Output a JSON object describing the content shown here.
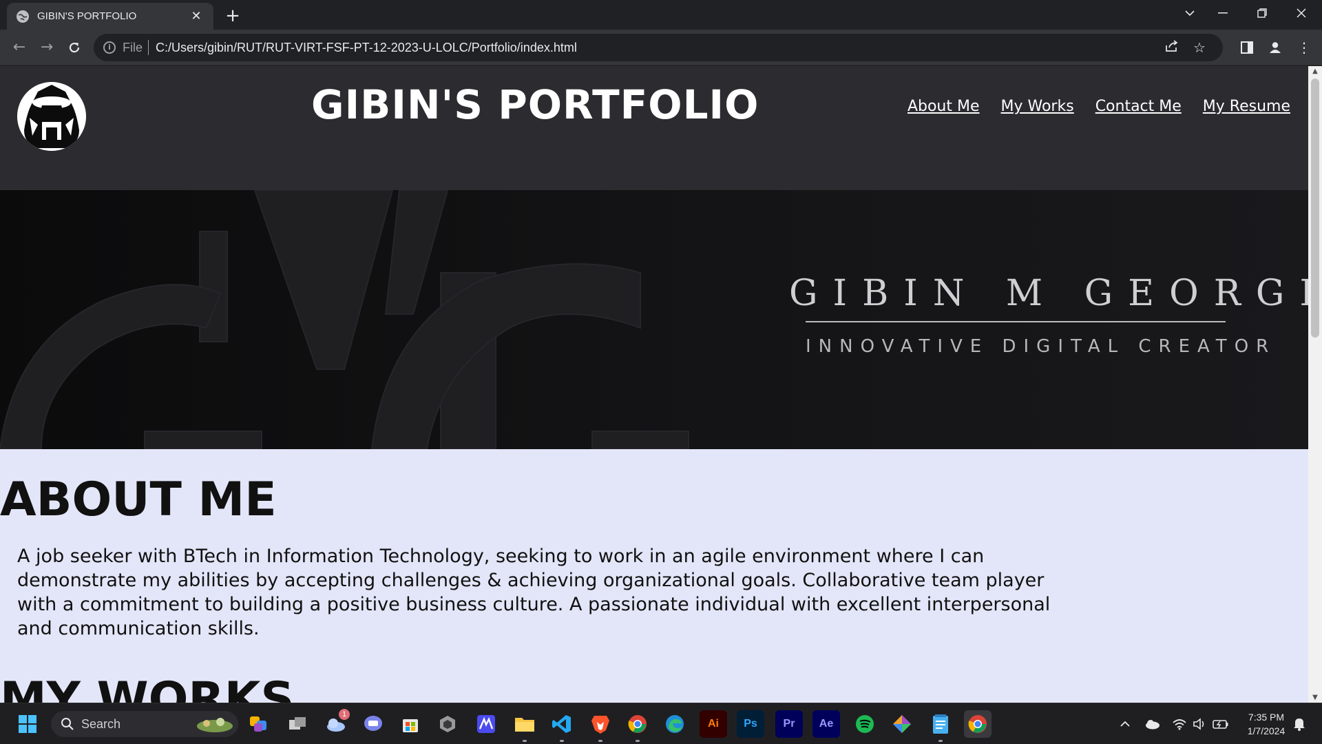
{
  "browser": {
    "tab_title": "GIBIN'S PORTFOLIO",
    "omnibox_scheme": "File",
    "url": "C:/Users/gibin/RUT/RUT-VIRT-FSF-PT-12-2023-U-LOLC/Portfolio/index.html"
  },
  "site": {
    "title": "GIBIN'S PORTFOLIO",
    "nav": [
      "About Me",
      "My Works",
      "Contact Me",
      "My Resume"
    ],
    "banner_name": "GIBIN M GEORGE",
    "banner_subtitle": "INNOVATIVE DIGITAL CREATOR",
    "about_heading": "ABOUT ME",
    "about_text": "A job seeker with BTech in Information Technology, seeking to work in an agile environment where I can demonstrate my abilities by accepting challenges & achieving organizational goals. Collaborative team player with a commitment to building a positive business culture. A passionate individual with excellent interpersonal and communication skills.",
    "works_heading": "MY WORKS"
  },
  "taskbar": {
    "search_label": "Search",
    "notification_badge": "1",
    "apps": {
      "illustrator": "Ai",
      "photoshop": "Ps",
      "premiere": "Pr",
      "after_effects": "Ae"
    },
    "time": "7:35 PM",
    "date": "1/7/2024"
  },
  "colors": {
    "header_bg": "#2b2b30",
    "page_bg": "#e3e6f8",
    "chrome_bg": "#202124",
    "toolbar_bg": "#35363a"
  }
}
